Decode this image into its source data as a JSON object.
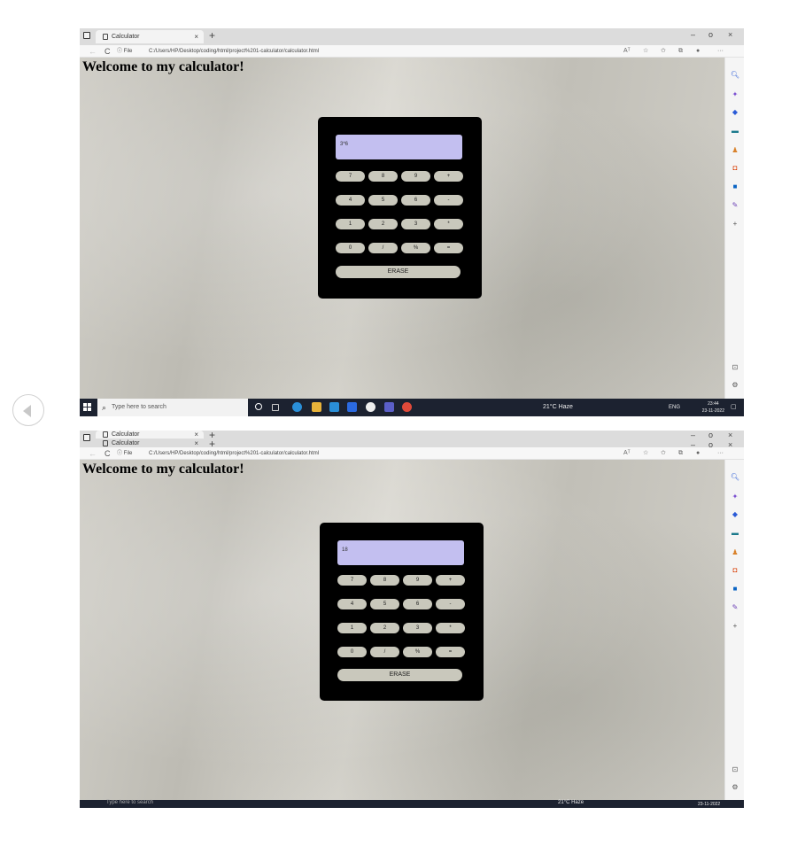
{
  "browser": {
    "tab_title": "Calculator",
    "tab_close": "×",
    "new_tab": "+",
    "minimize": "–",
    "maximize": "o",
    "close": "×",
    "back": "←",
    "refresh": "C",
    "site_info": "ⓘ File",
    "url": "C:/Users/HP/Desktop/coding/html/project%201-calculator/calculator.html",
    "read_aloud": "Aᵀ",
    "more": "···"
  },
  "page": {
    "heading": "Welcome to my calculator!"
  },
  "screens": [
    {
      "display": "3*6"
    },
    {
      "display": "18"
    }
  ],
  "keys": {
    "row1": [
      "7",
      "8",
      "9",
      "+"
    ],
    "row2": [
      "4",
      "5",
      "6",
      "-"
    ],
    "row3": [
      "1",
      "2",
      "3",
      "*"
    ],
    "row4": [
      "0",
      "/",
      "%",
      "="
    ],
    "erase": "ERASE"
  },
  "taskbar": {
    "search_placeholder": "Type here to search",
    "weather": "21°C  Haze",
    "lang": "ENG",
    "time": "23:44",
    "date": "23-11-2022"
  },
  "colors": {
    "display_bg": "#c3bff0",
    "key_bg": "#c9c8bc",
    "calc_bg": "#000000",
    "taskbar_bg": "#1c2230"
  },
  "icons": [
    "search-icon",
    "sparkle-icon",
    "tag-icon",
    "briefcase-icon",
    "games-icon",
    "office-icon",
    "outlook-icon",
    "pen-icon",
    "plus-icon",
    "settings-icon",
    "back-arrow-icon"
  ]
}
